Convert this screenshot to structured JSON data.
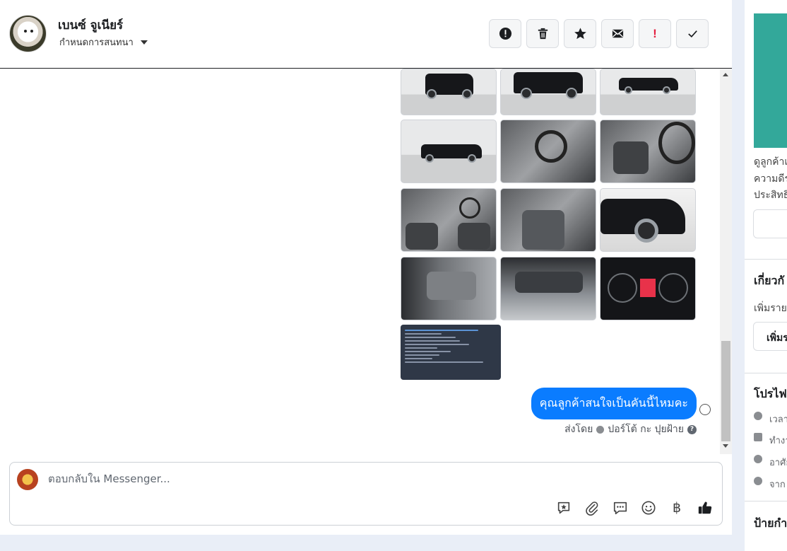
{
  "header": {
    "contact_name": "เบนซ์ จูเนียร์",
    "assign_label": "กำหนดการสนทนา"
  },
  "toolbar": {
    "icons": [
      "alert-circle-icon",
      "trash-icon",
      "star-icon",
      "envelope-icon",
      "important-icon",
      "check-icon"
    ],
    "important_glyph": "!"
  },
  "messages": {
    "outgoing_text": "คุณลูกค้าสนใจเป็นคันนี้ไหมคะ",
    "sent_by_label": "ส่งโดย",
    "sent_by_name": "ปอร์โต้ กะ ปุยฝ้าย",
    "help_glyph": "?"
  },
  "composer": {
    "placeholder": "ตอบกลับใน Messenger...",
    "tools": [
      "saved-reply-icon",
      "attachment-icon",
      "chat-bubble-icon",
      "emoji-icon",
      "baht-icon",
      "like-icon"
    ],
    "baht_glyph": "฿"
  },
  "right_panel": {
    "desc_lines": [
      "ดูลูกค้าเ",
      "ความดีร",
      "ประสิทธิ"
    ],
    "about_heading": "เกี่ยวกั",
    "about_add_text": "เพิ่มราย",
    "about_add_button": "เพิ่มร",
    "profile_heading": "โปรไฟ",
    "profile_items": [
      "เวลา",
      "ทำงา",
      "อาศัย",
      "จาก"
    ],
    "tags_heading": "ป้ายกำ"
  },
  "colors": {
    "accent": "#0a7cff",
    "danger": "#e41e3f",
    "teal": "#33a89a"
  }
}
